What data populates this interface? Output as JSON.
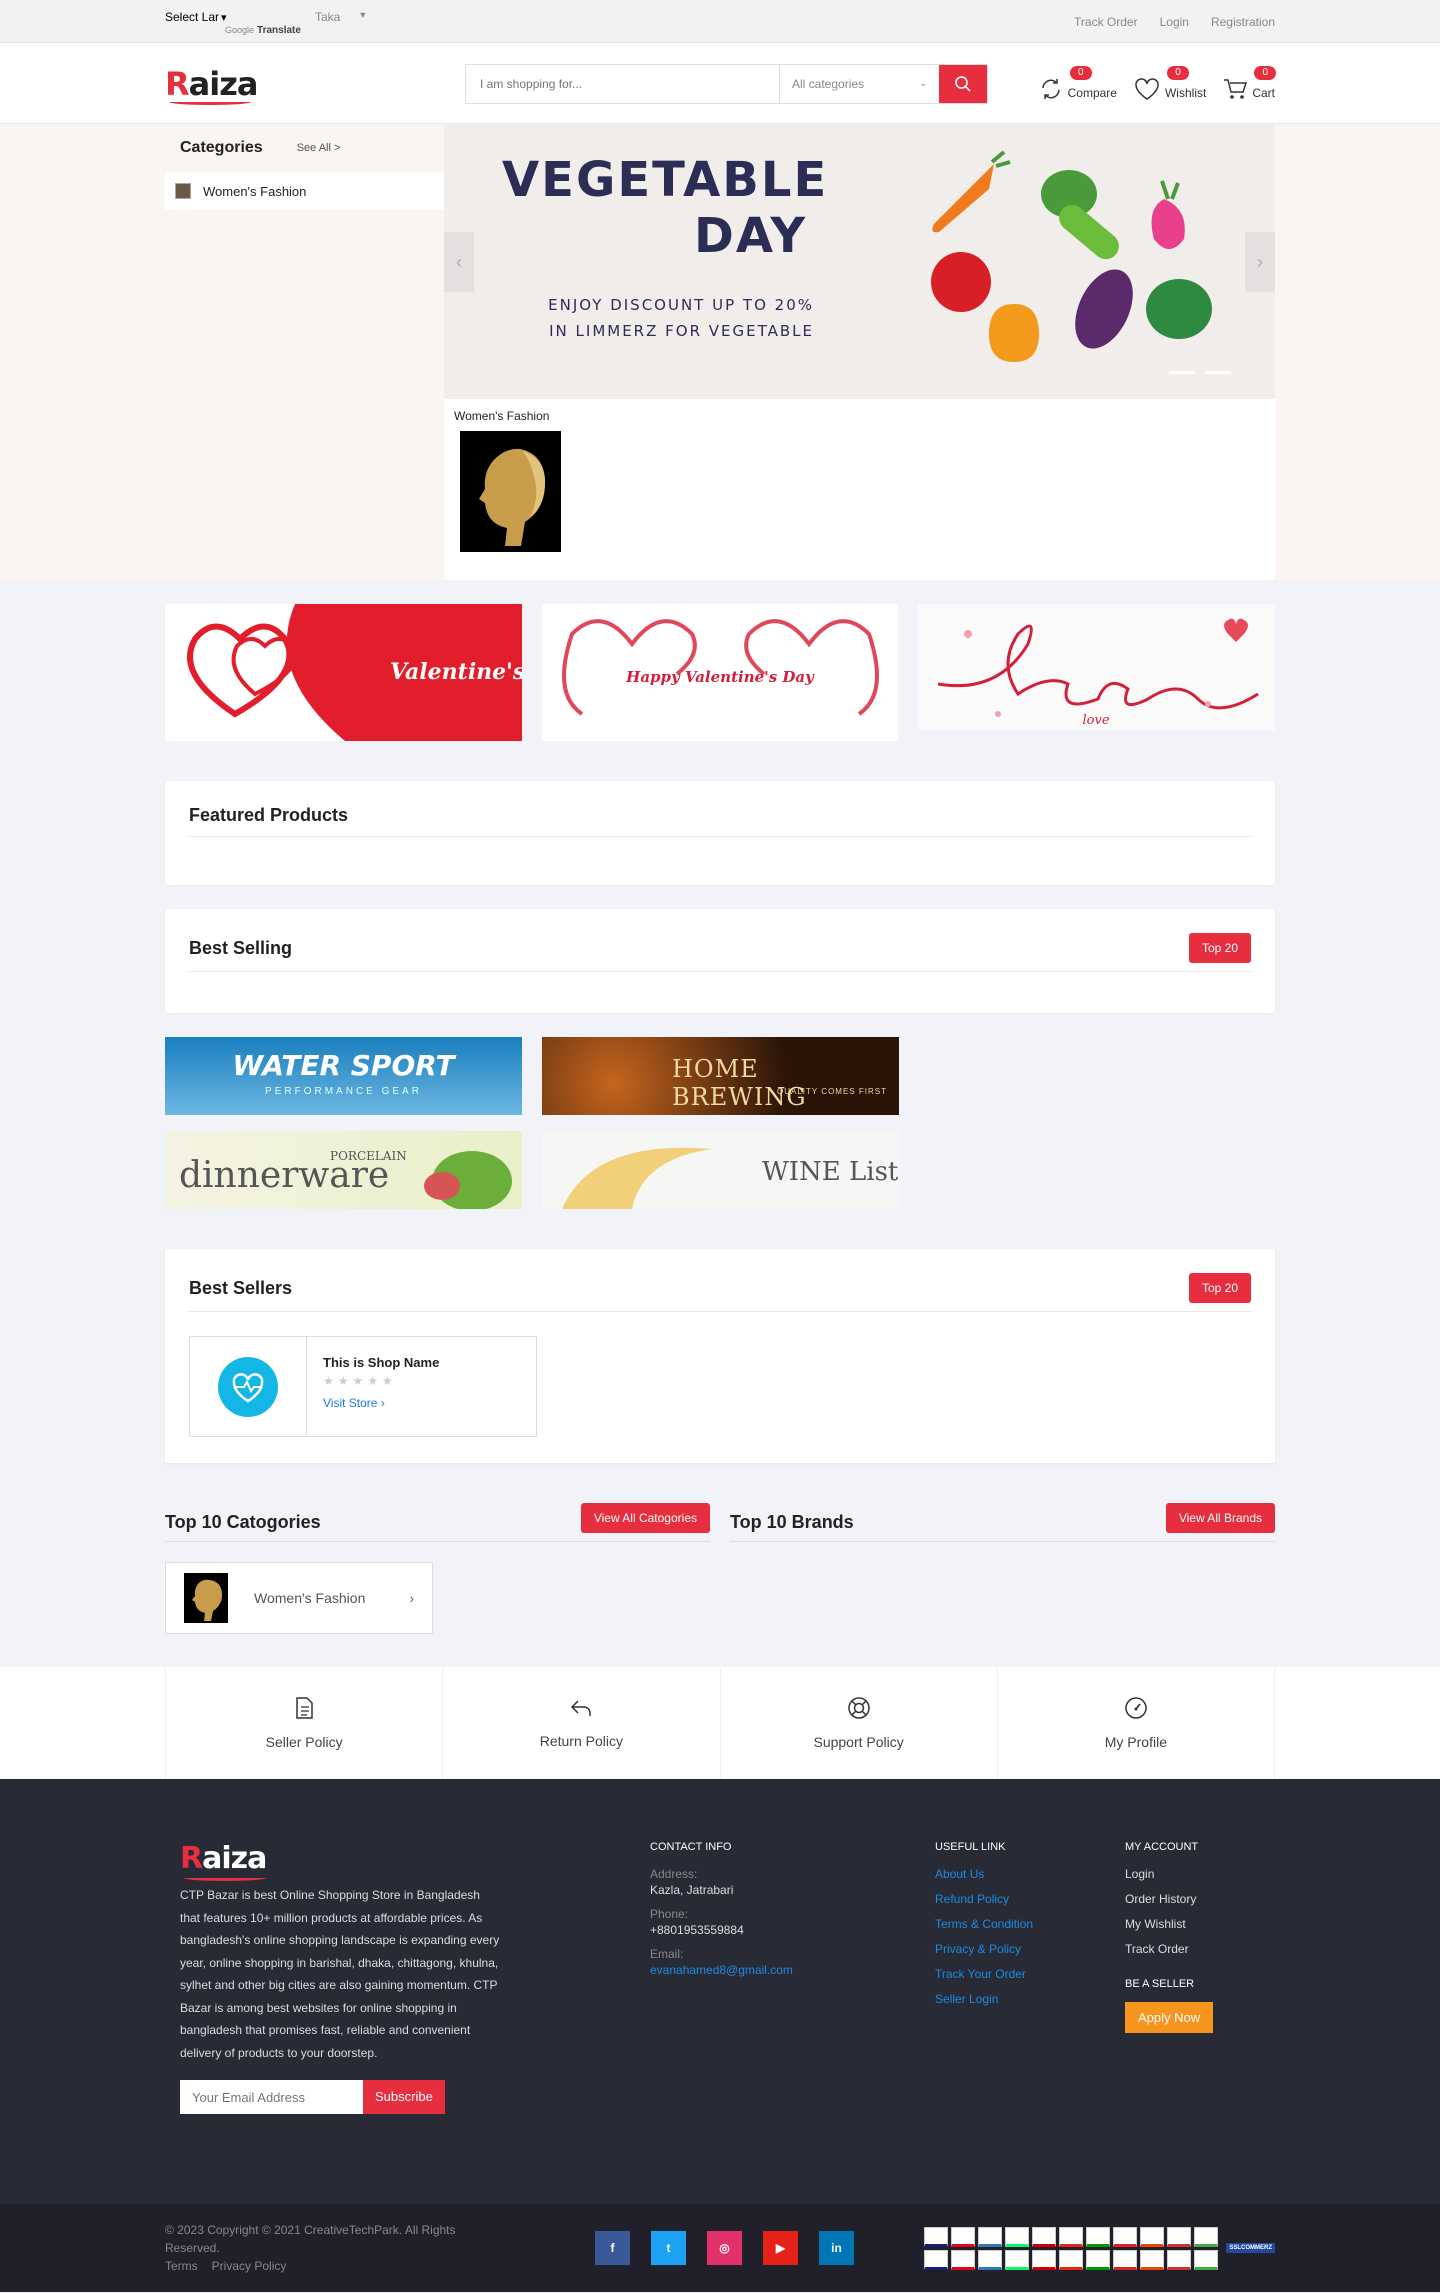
{
  "topbar": {
    "translate_select": "Select Lar",
    "translate_google": "Google",
    "translate_label": "Translate",
    "currency": "Taka",
    "links": [
      "Track Order",
      "Login",
      "Registration"
    ]
  },
  "header": {
    "logo_r": "R",
    "logo_rest": "aiza",
    "search_placeholder": "I am shopping for...",
    "category_select": "All categories",
    "compare_label": "Compare",
    "compare_count": "0",
    "wishlist_label": "Wishlist",
    "wishlist_count": "0",
    "cart_label": "Cart",
    "cart_count": "0"
  },
  "categories": {
    "title": "Categories",
    "see_all": "See All >",
    "items": [
      "Women's Fashion"
    ]
  },
  "slider": {
    "line1": "VEGETABLE",
    "line2": "DAY",
    "subtitle": "ENJOY DISCOUNT UP TO 20% IN LIMMERZ FOR VEGETABLE"
  },
  "hero_category": {
    "label": "Women's Fashion"
  },
  "banners_valentine": [
    {
      "text": "Valentine's"
    },
    {
      "text": "Happy Valentine's Day"
    },
    {
      "text": "love"
    }
  ],
  "featured": {
    "title": "Featured Products"
  },
  "best_selling": {
    "title": "Best Selling",
    "button": "Top 20"
  },
  "promo_banners": [
    {
      "title": "WATER SPORT",
      "sub": "PERFORMANCE GEAR"
    },
    {
      "title": "HOME BREWING",
      "sub": "QUALITY COMES FIRST"
    },
    {
      "title": "dinnerware",
      "sub": "PORCELAIN"
    },
    {
      "title": "WINE List",
      "sub": ""
    }
  ],
  "best_sellers": {
    "title": "Best Sellers",
    "button": "Top 20",
    "shop_name": "This is Shop Name",
    "stars": "★★★★★",
    "visit": "Visit Store"
  },
  "top_categories": {
    "title": "Top 10 Catogories",
    "button": "View All Catogories",
    "items": [
      "Women's Fashion"
    ]
  },
  "top_brands": {
    "title": "Top 10 Brands",
    "button": "View All Brands"
  },
  "policies": [
    "Seller Policy",
    "Return Policy",
    "Support Policy",
    "My Profile"
  ],
  "footer": {
    "about": "CTP Bazar is best Online Shopping Store in Bangladesh that features 10+ million products at affordable prices. As bangladesh's online shopping landscape is expanding every year, online shopping in barishal, dhaka, chittagong, khulna, sylhet and other big cities are also gaining momentum. CTP Bazar is among best websites for online shopping in bangladesh that promises fast, reliable and convenient delivery of products to your doorstep.",
    "email_placeholder": "Your Email Address",
    "subscribe": "Subscribe",
    "contact": {
      "title": "CONTACT INFO",
      "address_label": "Address:",
      "address": "Kazla, Jatrabari",
      "phone_label": "Phone:",
      "phone": "+8801953559884",
      "email_label": "Email:",
      "email": "evanahamed8@gmail.com"
    },
    "useful": {
      "title": "USEFUL LINK",
      "links": [
        "About Us",
        "Refund Policy",
        "Terms & Condition",
        "Privacy & Policy",
        "Track Your Order",
        "Seller Login"
      ]
    },
    "account": {
      "title": "MY ACCOUNT",
      "links": [
        "Login",
        "Order History",
        "My Wishlist",
        "Track Order"
      ],
      "seller_title": "BE A SELLER",
      "apply": "Apply Now"
    }
  },
  "bottom": {
    "copyright": "© 2023 Copyright © 2021 CreativeTechPark. All Rights Reserved.",
    "terms": "Terms",
    "privacy": "Privacy Policy",
    "social": [
      {
        "name": "facebook-icon",
        "glyph": "f",
        "color": "#3b5998"
      },
      {
        "name": "twitter-icon",
        "glyph": "t",
        "color": "#1da1f2"
      },
      {
        "name": "instagram-icon",
        "glyph": "◎",
        "color": "#e1306c"
      },
      {
        "name": "youtube-icon",
        "glyph": "▶",
        "color": "#e62117"
      },
      {
        "name": "linkedin-icon",
        "glyph": "in",
        "color": "#0077b5"
      }
    ],
    "payment_badge": "SSLCOMMERZ"
  },
  "colors": {
    "accent": "#e62e3e",
    "footer_bg": "#282a35",
    "link": "#1e8be0",
    "apply": "#f7941d"
  }
}
